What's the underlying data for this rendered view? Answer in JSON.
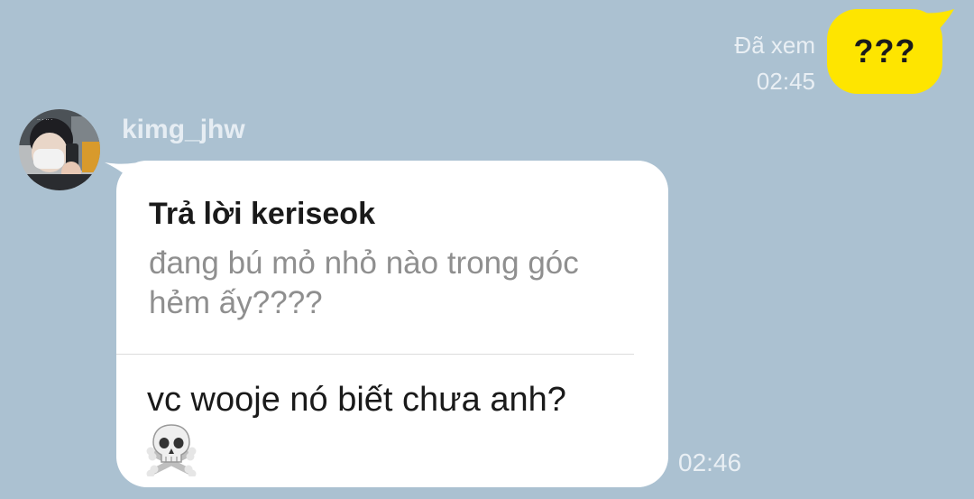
{
  "outgoing": {
    "read_status": "Đã xem",
    "time": "02:45",
    "text": "???",
    "bubble_color": "#fee500"
  },
  "incoming": {
    "sender": "kimg_jhw",
    "reply_title": "Trả lời keriseok",
    "reply_quote": "đang bú mỏ nhỏ nào trong góc hẻm ấy????",
    "text": "vc wooje nó biết chưa anh?",
    "emoji_icon": "skull-and-crossbones-icon",
    "time": "02:46"
  },
  "colors": {
    "background": "#abc1d1",
    "incoming_bubble": "#ffffff",
    "meta_text": "#e9eff4",
    "quote_text": "#8f8f8f"
  }
}
